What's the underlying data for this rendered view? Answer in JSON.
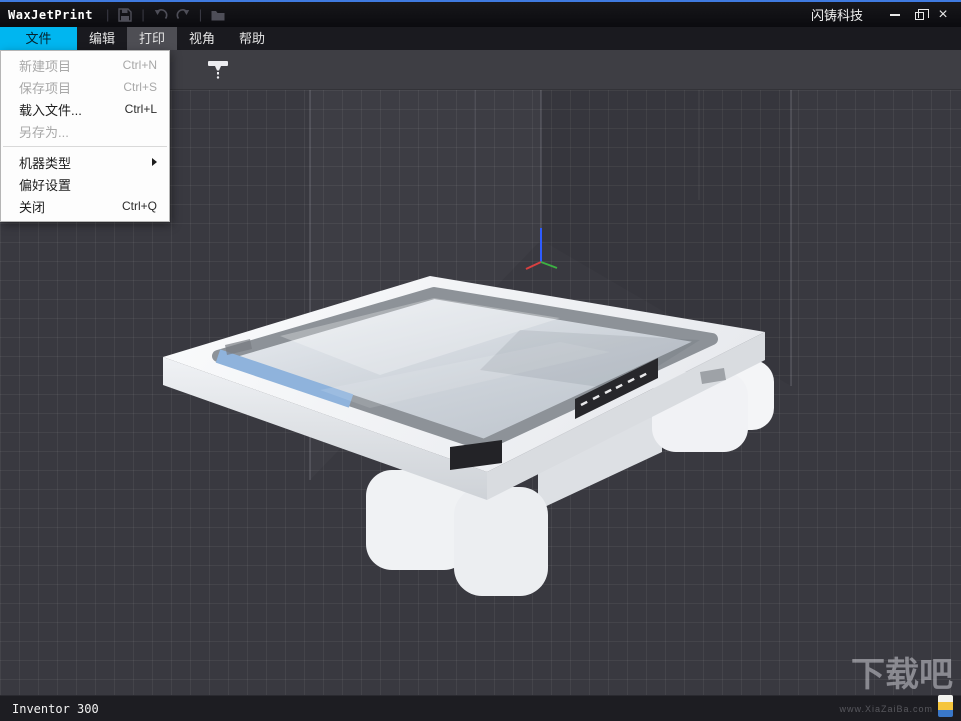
{
  "window": {
    "title": "WaxJetPrint",
    "brand": "闪铸科技",
    "close_glyph": "×"
  },
  "menubar": {
    "items": [
      {
        "label": "文件",
        "active": true
      },
      {
        "label": "编辑"
      },
      {
        "label": "打印"
      },
      {
        "label": "视角"
      },
      {
        "label": "帮助"
      }
    ]
  },
  "file_menu": {
    "items": [
      {
        "label": "新建项目",
        "shortcut": "Ctrl+N",
        "enabled": false
      },
      {
        "label": "保存项目",
        "shortcut": "Ctrl+S",
        "enabled": false
      },
      {
        "label": "载入文件...",
        "shortcut": "Ctrl+L",
        "enabled": true
      },
      {
        "label": "另存为...",
        "shortcut": "",
        "enabled": false
      },
      {
        "type": "separator"
      },
      {
        "label": "机器类型",
        "shortcut": "",
        "enabled": true,
        "has_submenu": true
      },
      {
        "label": "偏好设置",
        "shortcut": "",
        "enabled": true
      },
      {
        "label": "关闭",
        "shortcut": "Ctrl+Q",
        "enabled": true
      }
    ]
  },
  "statusbar": {
    "machine": "Inventor 300"
  },
  "watermark": {
    "text": "下载吧",
    "subtext": "www.XiaZaiBa.com"
  },
  "colors": {
    "menu_accent": "#00b6f0",
    "titlebar_line": "#3f7ae0",
    "axis_x": "#d84040",
    "axis_y": "#3cb043",
    "axis_z": "#2e5cff",
    "platform_accent": "#8fb3dc"
  }
}
